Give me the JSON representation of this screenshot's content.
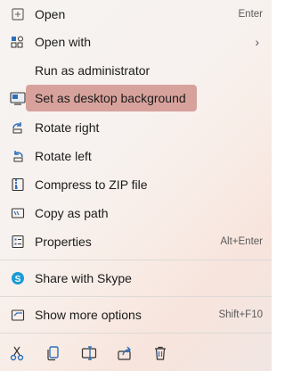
{
  "colors": {
    "highlight": "#d8a29c",
    "accent": "#1a73c9",
    "icon_blue": "#2f6fba"
  },
  "menu": {
    "items": [
      {
        "label": "Open",
        "shortcut": "Enter",
        "icon": "open-icon"
      },
      {
        "label": "Open with",
        "submenu_glyph": "›",
        "icon": "open-with-icon"
      },
      {
        "label": "Run as administrator"
      },
      {
        "label": "Set as desktop background",
        "icon": "desktop-background-icon",
        "highlighted": true
      },
      {
        "label": "Rotate right",
        "icon": "rotate-right-icon"
      },
      {
        "label": "Rotate left",
        "icon": "rotate-left-icon"
      },
      {
        "label": "Compress to ZIP file",
        "icon": "zip-icon"
      },
      {
        "label": "Copy as path",
        "icon": "copy-path-icon"
      },
      {
        "label": "Properties",
        "shortcut": "Alt+Enter",
        "icon": "properties-icon"
      },
      {
        "label": "Share with Skype",
        "icon": "skype-icon"
      },
      {
        "label": "Show more options",
        "shortcut": "Shift+F10",
        "icon": "show-more-icon"
      }
    ],
    "toolbar": [
      "cut-icon",
      "copy-icon",
      "rename-icon",
      "share-icon",
      "delete-icon"
    ]
  }
}
